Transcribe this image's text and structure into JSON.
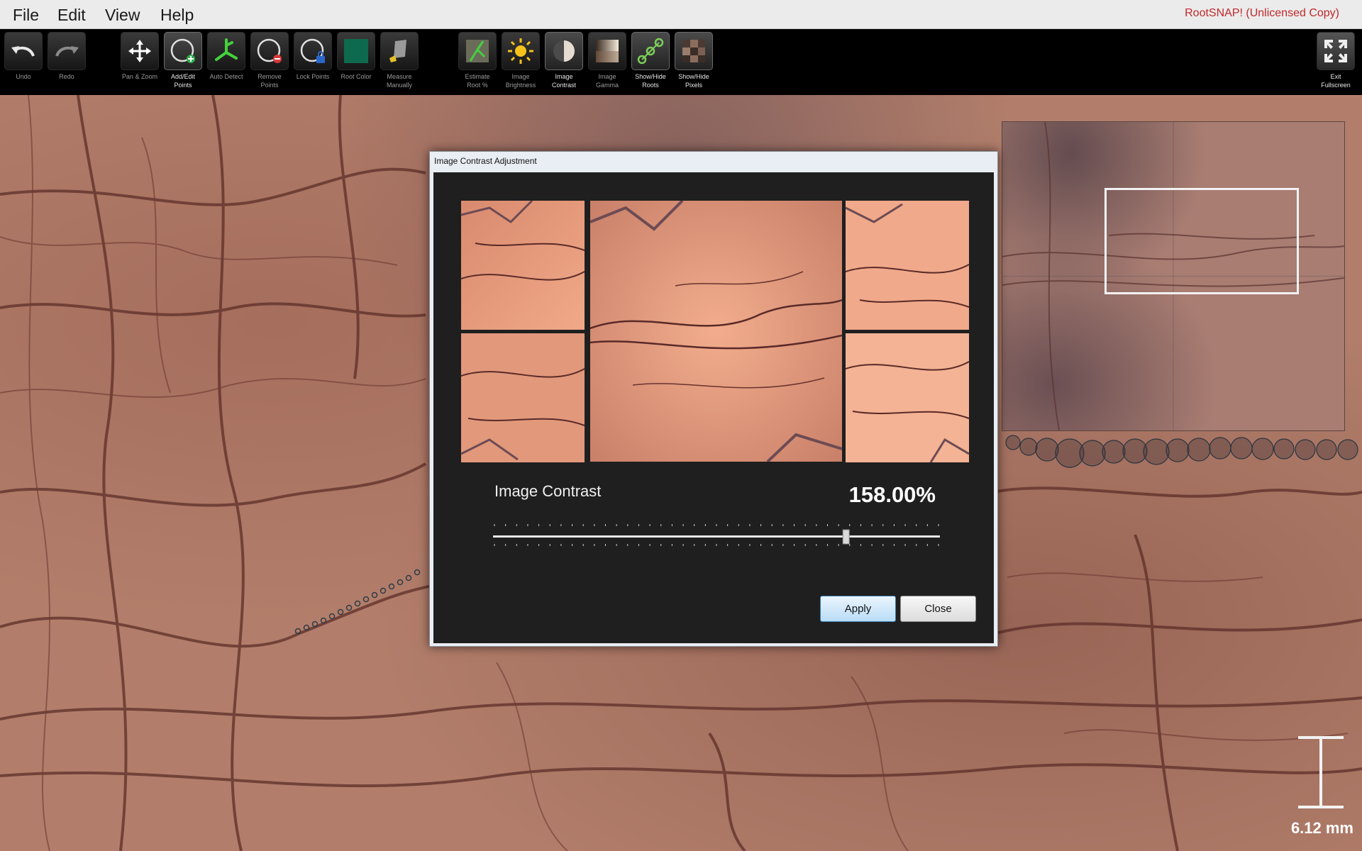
{
  "menu": {
    "items": [
      "File",
      "Edit",
      "View",
      "Help"
    ],
    "brand": "RootSNAP!  (Unlicensed Copy)"
  },
  "toolbar": {
    "tools": [
      {
        "label": "Undo",
        "icon": "undo-icon",
        "active": false
      },
      {
        "label": "Redo",
        "icon": "redo-icon",
        "active": false
      },
      {
        "label": "Pan & Zoom",
        "icon": "move-arrows-icon",
        "active": false
      },
      {
        "label": "Add/Edit\nPoints",
        "icon": "add-point-icon",
        "active": true
      },
      {
        "label": "Auto Detect",
        "icon": "auto-detect-roots-icon",
        "active": false
      },
      {
        "label": "Remove\nPoints",
        "icon": "remove-point-icon",
        "active": false
      },
      {
        "label": "Lock Points",
        "icon": "lock-point-icon",
        "active": false
      },
      {
        "label": "Root Color",
        "icon": "color-swatch-icon",
        "active": false
      },
      {
        "label": "Measure\nManually",
        "icon": "measure-manually-icon",
        "active": false
      },
      {
        "label": "Estimate\nRoot %",
        "icon": "estimate-root-icon",
        "active": false
      },
      {
        "label": "Image\nBrightness",
        "icon": "sun-icon",
        "active": false
      },
      {
        "label": "Image\nContrast",
        "icon": "contrast-icon",
        "active": true
      },
      {
        "label": "Image\nGamma",
        "icon": "gamma-icon",
        "active": false
      },
      {
        "label": "Show/Hide\nRoots",
        "icon": "roots-nodes-icon",
        "active": true
      },
      {
        "label": "Show/Hide\nPixels",
        "icon": "pixels-icon",
        "active": true
      },
      {
        "label": "Exit\nFullscreen",
        "icon": "exit-fullscreen-icon",
        "active": false
      }
    ]
  },
  "dialog": {
    "title": "Image Contrast Adjustment",
    "contrast_label": "Image Contrast",
    "contrast_value": "158.00%",
    "slider_fraction": 0.79,
    "apply_label": "Apply",
    "close_label": "Close"
  },
  "scale": {
    "label": "6.12 mm"
  },
  "colors": {
    "brand": "#c0282b",
    "root_color": "#0e6a4e",
    "soil": "#b27e6b"
  }
}
